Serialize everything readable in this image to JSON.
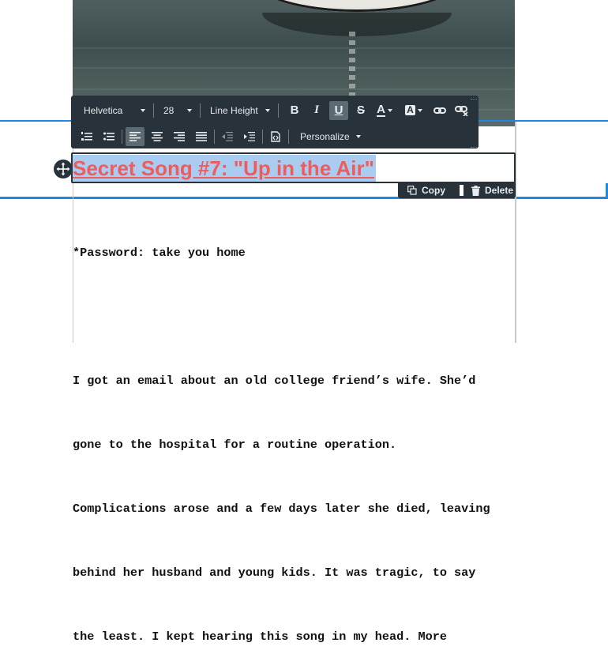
{
  "toolbar": {
    "font_family": "Helvetica",
    "font_size": "28",
    "line_height": "Line Height",
    "personalize": "Personalize",
    "buttons_row1": [
      "bold-icon",
      "italic-icon",
      "underline-icon",
      "strikethrough-icon",
      "text-color-icon",
      "background-color-icon",
      "link-icon",
      "unlink-icon"
    ],
    "buttons_row2": [
      "ordered-list-icon",
      "unordered-list-icon",
      "align-left-icon",
      "align-center-icon",
      "align-right-icon",
      "align-justify-icon",
      "outdent-icon",
      "indent-icon",
      "source-code-icon"
    ],
    "bold_label": "B",
    "italic_label": "I",
    "underline_label": "U",
    "strike_label": "S",
    "text_color_label": "A",
    "bg_color_label": "A"
  },
  "heading": {
    "text": "Secret Song #7: \"Up in the Air\"",
    "color": "#ef5c5c",
    "selection_color": "#a9ccf0"
  },
  "actions": {
    "copy_label": "Copy",
    "delete_label": "Delete"
  },
  "body": {
    "lines": [
      "*Password: take you home",
      "",
      "I got an email about an old college friend’s wife. She’d",
      "gone to the hospital for a routine operation.",
      "Complications arose and a few days later she died, leaving",
      "behind her husband and young kids. It was tragic, to say",
      "the least. I kept hearing this song in my head. More"
    ]
  },
  "colors": {
    "selection_band": "#1e88e5",
    "toolbar_bg": "#27323a"
  }
}
